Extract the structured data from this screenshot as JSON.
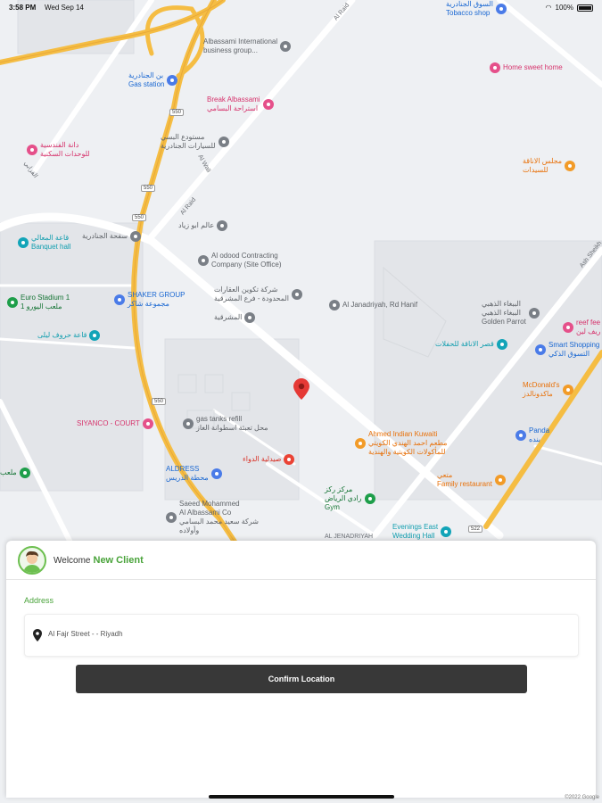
{
  "status_bar": {
    "time": "3:58 PM",
    "date": "Wed Sep 14",
    "battery": "100%"
  },
  "map": {
    "pois": [
      {
        "id": "albassami-intl",
        "text": "Albassami International\nbusiness group...",
        "color": "gray"
      },
      {
        "id": "gas-station",
        "text": "بن الجنادرية\nGas station",
        "color": "blue"
      },
      {
        "id": "break-albassami",
        "text": "Break Albassami\nاستراحة البسامي",
        "color": "pink"
      },
      {
        "id": "car-showroom",
        "text": "مستودع البسي\nللسيارات الجنادرية",
        "color": "gray"
      },
      {
        "id": "housing-units",
        "text": "دانة الفندسية\nللوحدات السكنية",
        "color": "pink"
      },
      {
        "id": "jenadriyah-square",
        "text": "سفحة الجنادرية",
        "color": "gray"
      },
      {
        "id": "banquet-hall",
        "text": "قاعة المعالي\nBanquet hall",
        "color": "teal"
      },
      {
        "id": "abu-zaid",
        "text": "عالم ابو زياد",
        "color": "gray"
      },
      {
        "id": "al-odood",
        "text": "Al odood Contracting\nCompany (Site Office)",
        "color": "gray"
      },
      {
        "id": "real-estate",
        "text": "شركة تكوين العقارات\nالمحدودة - فرع المشرقية",
        "color": "gray"
      },
      {
        "id": "al-mashriqiya",
        "text": "المشرقية",
        "color": "gray"
      },
      {
        "id": "al-janadriyah-rd",
        "text": "Al Janadriyah, Rd Hanif",
        "color": "gray"
      },
      {
        "id": "shaker-group",
        "text": "SHAKER GROUP\nمجموعة شاكر",
        "color": "blue"
      },
      {
        "id": "euro-stadium",
        "text": "Euro Stadium 1\nملعب اليورو 1",
        "color": "green"
      },
      {
        "id": "letters-hall",
        "text": "قاعة حروف ليلى",
        "color": "teal"
      },
      {
        "id": "golden-parrot",
        "text": "الببغاء الذهبي\nالببغاء الذهبي\nGolden Parrot",
        "color": "gray"
      },
      {
        "id": "reef-fee",
        "text": "reef fee\nريف لين",
        "color": "pink"
      },
      {
        "id": "smart-shopping",
        "text": "Smart Shopping\nالتسوق الذكي",
        "color": "blue"
      },
      {
        "id": "fashion-center",
        "text": "قصر الاناقة للحفلات",
        "color": "teal"
      },
      {
        "id": "mcdonalds",
        "text": "McDonald's\nماكدونالدز",
        "color": "orange"
      },
      {
        "id": "panda",
        "text": "Panda\nبنده",
        "color": "blue"
      },
      {
        "id": "gas-tanks",
        "text": "gas tanks refill\nمحل تعبئة اسطوانة الغاز",
        "color": "gray"
      },
      {
        "id": "siyanco",
        "text": "SIYANCO - COURT",
        "color": "pink"
      },
      {
        "id": "ahmed-indian",
        "text": "Ahmed Indian Kuwaiti\nمطعم احمد الهندي الكويتي\nللمأكولات الكويتية والهندية",
        "color": "orange"
      },
      {
        "id": "pharmacy",
        "text": "صيدلية الدواء",
        "color": "red"
      },
      {
        "id": "aldress",
        "text": "ALDRESS\nمحطة الدريس",
        "color": "blue"
      },
      {
        "id": "saeed-albassami",
        "text": "Saeed Mohammed\nAl Albassami Co\nشركة سعيد محمد البسامي\nوأولاده",
        "color": "gray"
      },
      {
        "id": "rayyan-center",
        "text": "مركز ركز\nرادي الرياض\nGym",
        "color": "green"
      },
      {
        "id": "family-restaurant",
        "text": "متعي\nFamily restaurant",
        "color": "orange"
      },
      {
        "id": "evenings-east",
        "text": "Evenings East\nWedding Hall",
        "color": "teal"
      },
      {
        "id": "home-sweet-home",
        "text": "Home sweet home",
        "color": "pink"
      },
      {
        "id": "tobacco-shop",
        "text": "السوق الجنادرية\nTobacco shop",
        "color": "blue"
      },
      {
        "id": "ladies-lounge",
        "text": "مجلس الاناقة\nللسيدات",
        "color": "orange"
      },
      {
        "id": "stadium-left",
        "text": "ملعب",
        "color": "green"
      }
    ],
    "roads": [
      {
        "id": "al-raid-top",
        "text": "Al Raid"
      },
      {
        "id": "al-raid",
        "text": "Al Raid"
      },
      {
        "id": "al-wali",
        "text": "Al Wali"
      },
      {
        "id": "al-jenadriyah-road",
        "text": "AL JENADRIYAH"
      },
      {
        "id": "ash-sheikh",
        "text": "Ash Sheikh"
      },
      {
        "id": "al-farabi",
        "text": "الفرابي"
      }
    ],
    "shields": [
      "550",
      "550",
      "550",
      "550",
      "522"
    ]
  },
  "sheet": {
    "welcome": "Welcome",
    "client_name": "New Client",
    "address_label": "Address",
    "address_text": "Al Fajr Street - - Riyadh",
    "confirm_label": "Confirm Location"
  },
  "footer": {
    "copyright": "©2022 Google"
  }
}
